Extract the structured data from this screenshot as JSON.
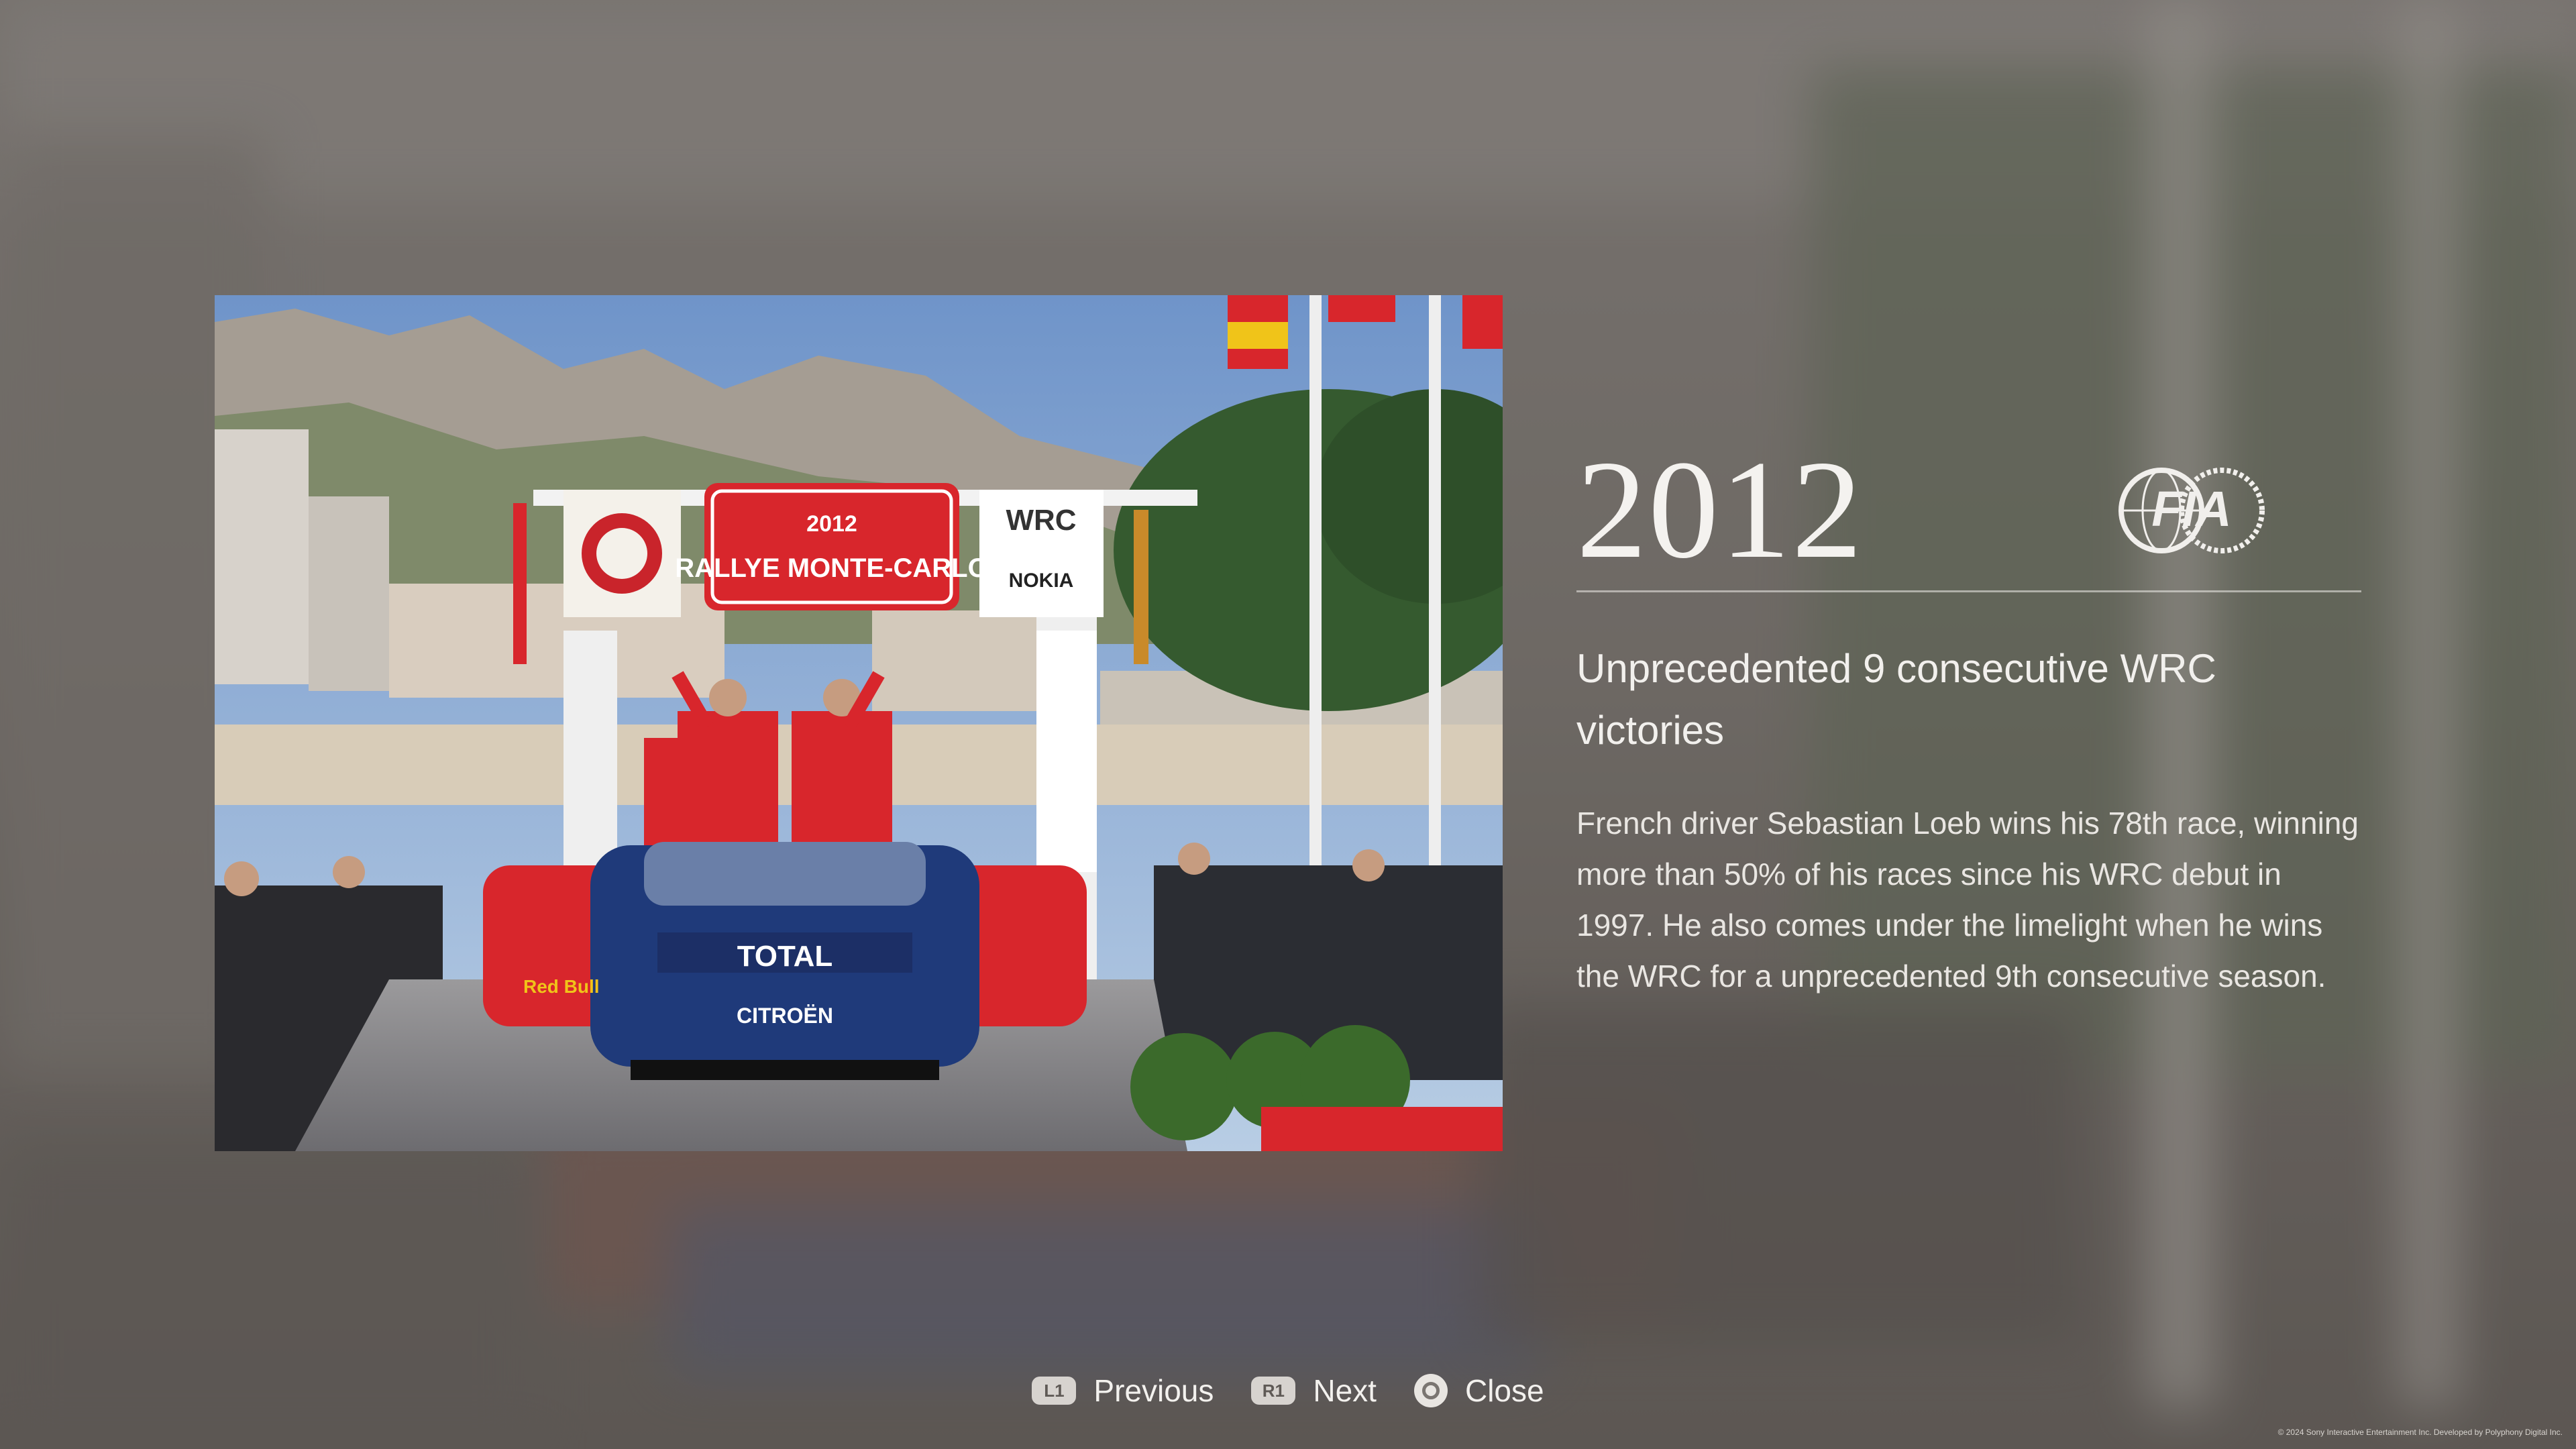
{
  "event": {
    "year": "2012",
    "org_logo_text": "FIA",
    "headline": "Unprecedented 9 consecutive WRC victories",
    "description": "French driver Sebastian Loeb wins his 78th race, winning more than 50% of his races since his WRC debut in 1997.  He also comes under the limelight when he wins the WRC for a unprecedented 9th consecutive season."
  },
  "photo": {
    "banner_top": "2012",
    "banner_main": "RALLYE MONTE-CARLO",
    "sign_wrc": "WRC",
    "sign_sponsor": "NOKIA",
    "car_sponsor": "TOTAL",
    "car_brand": "CITROËN",
    "drink_brand": "Red Bull"
  },
  "controls": {
    "previous": {
      "button": "L1",
      "label": "Previous"
    },
    "next": {
      "button": "R1",
      "label": "Next"
    },
    "close": {
      "label": "Close"
    }
  },
  "footer": {
    "copyright": "© 2024 Sony Interactive Entertainment Inc. Developed by Polyphony Digital Inc."
  }
}
